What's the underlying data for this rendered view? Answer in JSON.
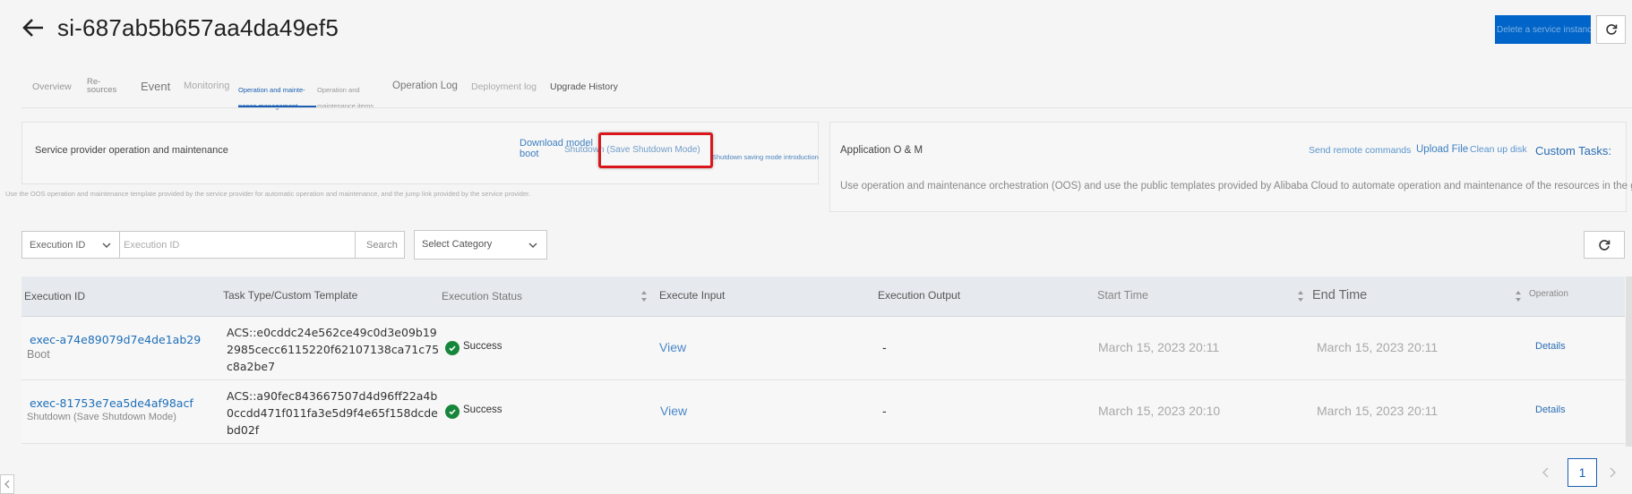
{
  "header": {
    "title": "si-687ab5b657aa4da49ef5",
    "delete_label": "Delete a service instance"
  },
  "tabs": [
    {
      "label": "Overview"
    },
    {
      "label": "Re-\nsources"
    },
    {
      "label": "Event"
    },
    {
      "label": "Monitoring"
    },
    {
      "label": "Operation and mainte-",
      "label2": "nance management"
    },
    {
      "label": "Operation and",
      "label2": "maintenance items"
    },
    {
      "label": "Operation Log"
    },
    {
      "label": "Deployment log"
    },
    {
      "label": "Upgrade History"
    }
  ],
  "provider_card": {
    "title": "Service provider operation and maintenance",
    "download_model": "Download model",
    "boot": "boot",
    "shutdown": "Shutdown (Save Shutdown Mode)",
    "intro": "Shutdown saving mode introduction",
    "description": "Use the OOS operation and maintenance template provided by the service provider for automatic operation and maintenance, and the jump link provided by the service provider."
  },
  "app_card": {
    "title": "Application O & M",
    "send_commands": "Send remote commands",
    "upload_file": "Upload File",
    "clean_disk": "Clean up disk",
    "custom_tasks": "Custom Tasks:",
    "description": "Use operation and maintenance orchestration (OOS) and use the public templates provided by Alibaba Cloud to automate operation and maintenance of the resources in the group."
  },
  "filter": {
    "field_select": "Execution ID",
    "search_placeholder": "Execution ID",
    "search_button": "Search",
    "category_placeholder": "Select Category"
  },
  "table": {
    "columns": [
      "Execution ID",
      "Task Type/Custom Template",
      "Execution Status",
      "Execute Input",
      "Execution Output",
      "Start Time",
      "End Time",
      "Operation"
    ],
    "rows": [
      {
        "id": "exec-a74e89079d7e4de1ab29",
        "subtitle": "Boot",
        "template": [
          "ACS::e0cddc24e562ce49c0d3e09b19",
          "2985cecc6115220f62107138ca71c75",
          "c8a2be7"
        ],
        "status": "Success",
        "input": "View",
        "output": "-",
        "start": "March 15, 2023 20:11",
        "end": "March 15, 2023 20:11",
        "op": "Details"
      },
      {
        "id": "exec-81753e7ea5de4af98acf",
        "subtitle": "Shutdown (Save Shutdown Mode)",
        "template": [
          "ACS::a90fec843667507d4d96ff22a4b",
          "0ccdd471f011fa3e5d9f4e65f158dcde",
          "bd02f"
        ],
        "status": "Success",
        "input": "View",
        "output": "-",
        "start": "March 15, 2023 20:10",
        "end": "March 15, 2023 20:11",
        "op": "Details"
      }
    ]
  },
  "pagination": {
    "current": "1"
  },
  "colors": {
    "primary": "#0064c8",
    "link": "#3c7fc0",
    "success": "#16873a",
    "highlight": "#d8161b"
  }
}
